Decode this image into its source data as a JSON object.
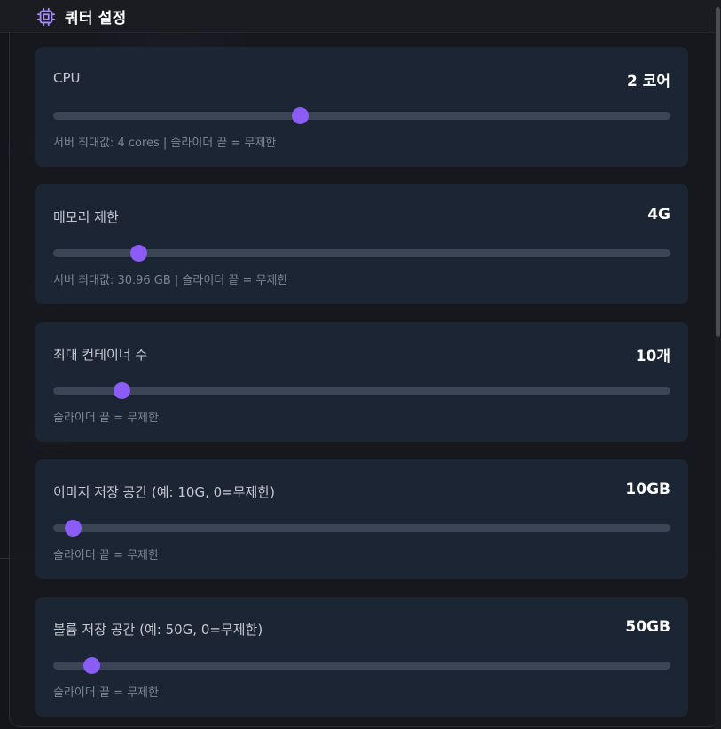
{
  "header": {
    "title": "쿼터 설정",
    "icon": "cpu-chip-icon",
    "icon_color": "#a78bfa"
  },
  "accent_color": "#8b5cf6",
  "quotas": [
    {
      "label": "CPU",
      "value": "2 코어",
      "hint": "서버 최대값: 4 cores | 슬라이더 끝 = 무제한",
      "slider_fraction": 0.4
    },
    {
      "label": "메모리 제한",
      "value": "4G",
      "hint": "서버 최대값: 30.96 GB | 슬라이더 끝 = 무제한",
      "slider_fraction": 0.139
    },
    {
      "label": "최대 컨테이너 수",
      "value": "10개",
      "hint": "슬라이더 끝 = 무제한",
      "slider_fraction": 0.111
    },
    {
      "label": "이미지 저장 공간 (예: 10G, 0=무제한)",
      "value": "10GB",
      "hint": "슬라이더 끝 = 무제한",
      "slider_fraction": 0.033
    },
    {
      "label": "볼륨 저장 공간 (예: 50G, 0=무제한)",
      "value": "50GB",
      "hint": "슬라이더 끝 = 무제한",
      "slider_fraction": 0.063
    }
  ]
}
